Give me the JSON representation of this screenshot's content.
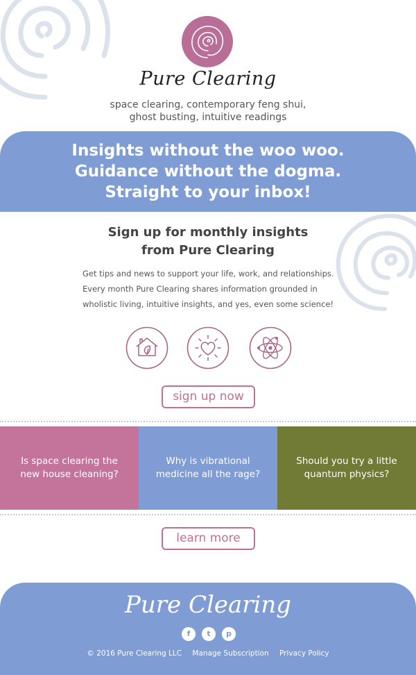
{
  "header": {
    "brand": "Pure Clearing",
    "tagline_line1": "space clearing, contemporary feng shui,",
    "tagline_line2": "ghost busting, intuitive readings"
  },
  "banner": {
    "line1": "Insights without the woo woo.",
    "line2": "Guidance without the dogma.",
    "line3": "Straight to your inbox!"
  },
  "signup": {
    "title_line1": "Sign up for monthly insights",
    "title_line2": "from Pure Clearing",
    "desc_line1": "Get tips and news to support your life, work, and relationships.",
    "desc_line2": "Every month Pure Clearing shares information grounded in",
    "desc_line3": "wholistic living, intuitive insights, and yes, even some science!",
    "icons": [
      "house-leaf-icon",
      "heart-sun-icon",
      "atom-icon"
    ],
    "button_label": "sign up now"
  },
  "tiles": [
    {
      "label": "Is space clearing the new house cleaning?",
      "color": "#c4739a"
    },
    {
      "label": "Why is vibrational medicine all the rage?",
      "color": "#7f9dd4"
    },
    {
      "label": "Should you try a little quantum physics?",
      "color": "#717b36"
    }
  ],
  "learn_more": {
    "button_label": "learn more"
  },
  "footer": {
    "brand": "Pure Clearing",
    "social": [
      {
        "icon": "facebook-icon",
        "glyph": "f"
      },
      {
        "icon": "twitter-icon",
        "glyph": "t"
      },
      {
        "icon": "pinterest-icon",
        "glyph": "p"
      }
    ],
    "copyright": "© 2016 Pure Clearing LLC",
    "manage": "Manage Subscription",
    "privacy": "Privacy Policy"
  },
  "colors": {
    "accent_pink": "#c46e97",
    "banner_blue": "#7f9dd4",
    "olive": "#717b36",
    "swirl": "#dbe2ec"
  }
}
